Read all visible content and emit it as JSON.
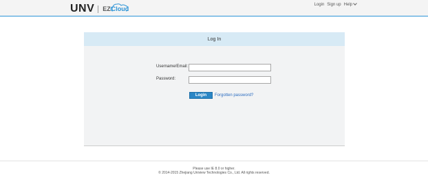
{
  "header": {
    "logo_unv": "UNV",
    "logo_ez": "EZ",
    "logo_cloud": "Cloud",
    "nav": {
      "login": "Login",
      "signup": "Sign up",
      "help": "Help"
    }
  },
  "panel": {
    "title": "Log In",
    "username_label": "Username/Email:",
    "username_value": "",
    "password_label": "Password:",
    "password_value": "",
    "login_button": "Login",
    "forgot_link": "Forgotten password?"
  },
  "footer": {
    "line1": "Please use IE 8.0 or higher.",
    "line2": "© 2014-2015 Zhejiang Uniview Technologies Co., Ltd. All rights reserved."
  },
  "colors": {
    "accent": "#2b93d6",
    "panel_header_bg": "#d7eaf5",
    "panel_bg": "#f2f3f4",
    "button_bg": "#2b86c5"
  },
  "icons": [
    "chevron-down-icon",
    "cloud-logo-icon"
  ]
}
